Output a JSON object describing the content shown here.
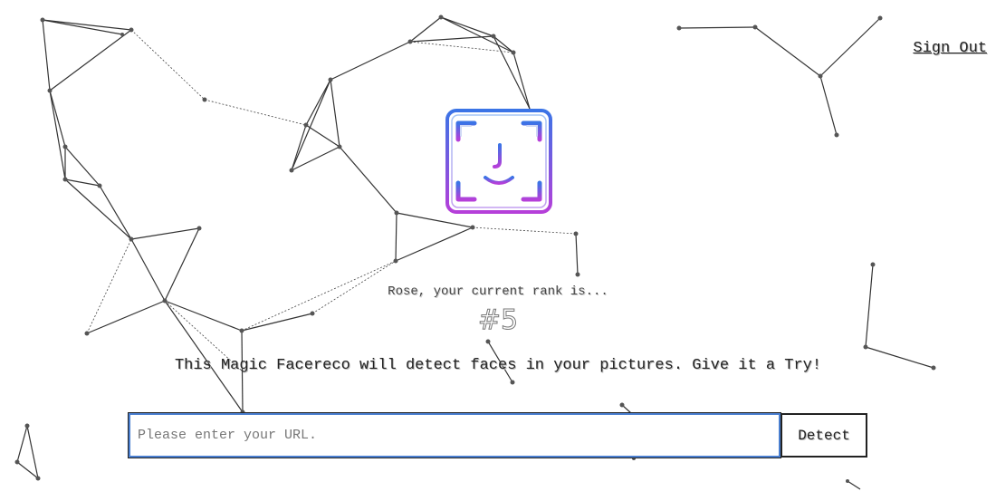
{
  "nav": {
    "sign_out_label": "Sign Out"
  },
  "logo": {
    "icon": "face-recognition-icon"
  },
  "rank": {
    "message": "Rose, your current rank is...",
    "value": "#5"
  },
  "tagline": "This Magic Facereco will detect faces in your pictures. Give it a Try!",
  "form": {
    "url_placeholder": "Please enter your URL.",
    "url_value": "",
    "detect_label": "Detect"
  },
  "colors": {
    "logo_gradient_top": "#3b74e6",
    "logo_gradient_bottom": "#b53fd9",
    "input_border": "#4a7fd0",
    "particles": "#333333"
  }
}
